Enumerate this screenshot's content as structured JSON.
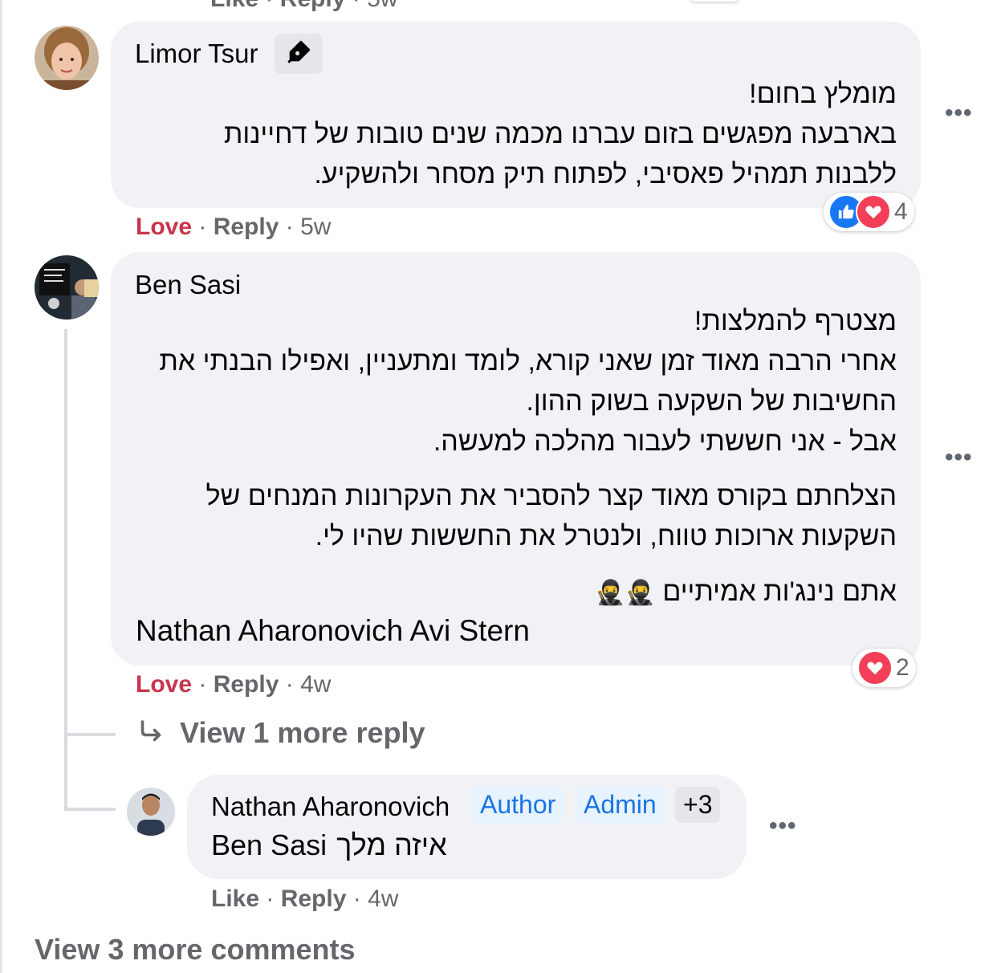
{
  "top_partial": {
    "like": "Like",
    "reply": "Reply",
    "time": "5w"
  },
  "comments": [
    {
      "author": "Limor Tsur",
      "lines": [
        "מומלץ בחום!",
        "בארבעה מפגשים בזום עברנו מכמה שנים טובות של דחיינות",
        "ללבנות תמהיל פאסיבי, לפתוח תיק מסחר ולהשקיע."
      ],
      "reaction_count": "4",
      "actions": {
        "love": "Love",
        "reply": "Reply",
        "time": "5w"
      }
    },
    {
      "author": "Ben Sasi",
      "lines": [
        "מצטרף להמלצות!",
        "אחרי הרבה מאוד זמן שאני קורא, לומד ומתעניין, ואפילו הבנתי את",
        "החשיבות של השקעה בשוק ההון.",
        "אבל - אני חששתי לעבור מהלכה למעשה.",
        "הצלחתם בקורס מאוד קצר להסביר את העקרונות המנחים של",
        "השקעות ארוכות טווח, ולנטרל את החששות שהיו לי.",
        "אתם נינג'ות אמיתיים"
      ],
      "emojis": [
        "🥷",
        "🥷"
      ],
      "mentions": "Nathan Aharonovich Avi Stern",
      "reaction_count": "2",
      "actions": {
        "love": "Love",
        "reply": "Reply",
        "time": "4w"
      },
      "view_more_replies": "View 1 more reply"
    }
  ],
  "reply": {
    "author": "Nathan Aharonovich",
    "badges": [
      "Author",
      "Admin",
      "+3"
    ],
    "mention": "Ben Sasi",
    "text": "איזה מלך",
    "actions": {
      "like": "Like",
      "reply": "Reply",
      "time": "4w"
    }
  },
  "view_more_comments": "View 3 more comments",
  "icons": {
    "more": "more-options-icon",
    "pen": "top-contributor-pen-icon",
    "arrow": "reply-arrow-icon"
  },
  "colors": {
    "love": "#c9354c",
    "like_blue": "#1877f2",
    "badge_blue": "#1b74e4",
    "bubble": "#f0f2f5"
  }
}
